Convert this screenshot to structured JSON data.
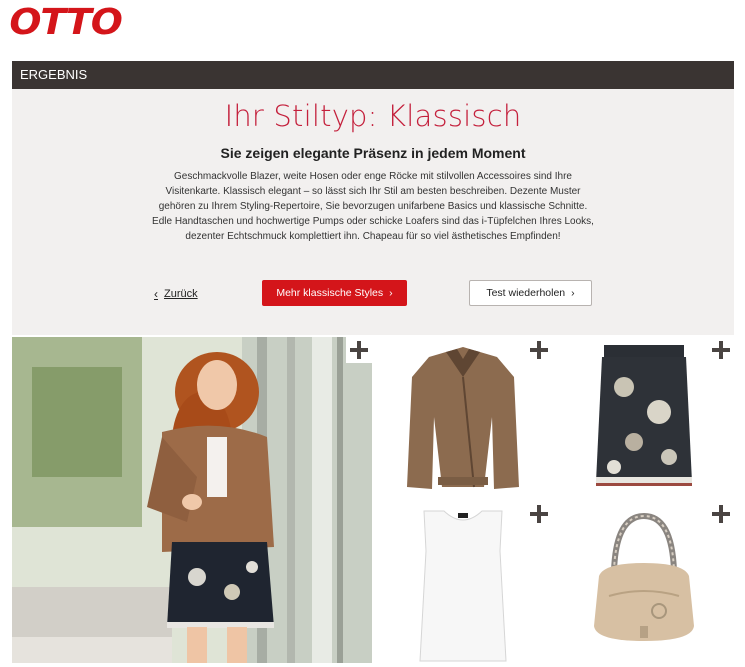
{
  "brand": {
    "logo_text": "OTTO",
    "color": "#d4151a"
  },
  "result_bar": {
    "label": "ERGEBNIS"
  },
  "result": {
    "title": "Ihr Stiltyp: Klassisch",
    "subtitle": "Sie zeigen elegante Präsenz in jedem Moment",
    "description": "Geschmackvolle Blazer, weite Hosen oder enge Röcke mit stilvollen Accessoires sind Ihre Visitenkarte. Klassisch elegant – so lässt sich Ihr Stil am besten beschreiben. Dezente Muster gehören zu Ihrem Styling-Repertoire, Sie bevorzugen unifarbene Basics und klassische Schnitte. Edle Handtaschen und hochwertige Pumps oder schicke Loafers sind das i-Tüpfelchen Ihres Looks, dezenter Echtschmuck komplettiert ihn. Chapeau für so viel ästhetisches Empfinden!"
  },
  "actions": {
    "back_label": "Zurück",
    "primary_label": "Mehr klassische Styles",
    "secondary_label": "Test wiederholen"
  },
  "products": [
    {
      "name": "model-look"
    },
    {
      "name": "leather-jacket"
    },
    {
      "name": "floral-skirt"
    },
    {
      "name": "white-top"
    },
    {
      "name": "beige-handbag"
    }
  ],
  "colors": {
    "accent": "#c4203c",
    "dark_bar": "#3a3432",
    "panel": "#f2f0ef"
  }
}
